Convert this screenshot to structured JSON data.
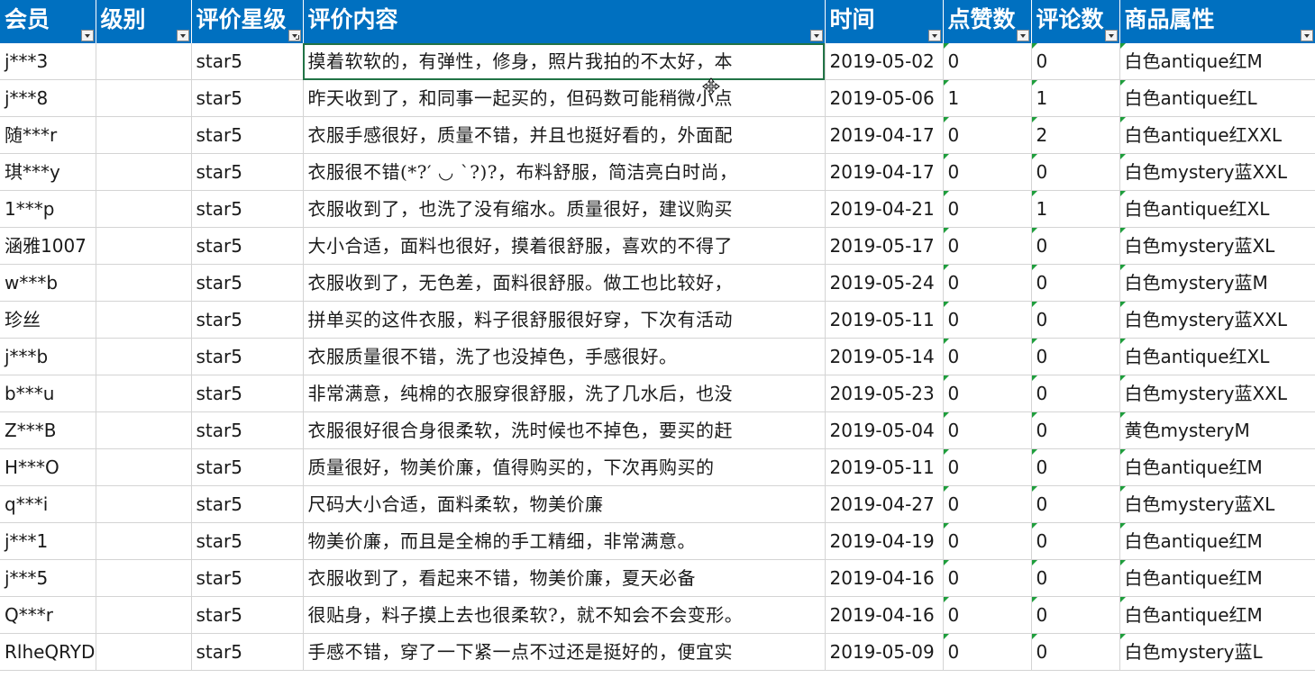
{
  "columns": [
    "会员",
    "级别",
    "评价星级",
    "评价内容",
    "时间",
    "点赞数",
    "评论数",
    "商品属性"
  ],
  "rows": [
    {
      "member": "j***3",
      "level": "",
      "stars": "star5",
      "content": "摸着软软的，有弹性，修身，照片我拍的不太好，本",
      "time": "2019-05-02",
      "likes": "0",
      "comments": "0",
      "attr": "白色antique红M"
    },
    {
      "member": "j***8",
      "level": "",
      "stars": "star5",
      "content": "昨天收到了，和同事一起买的，但码数可能稍微小点",
      "time": "2019-05-06",
      "likes": "1",
      "comments": "1",
      "attr": "白色antique红L"
    },
    {
      "member": "随***r",
      "level": "",
      "stars": "star5",
      "content": "衣服手感很好，质量不错，并且也挺好看的，外面配",
      "time": "2019-04-17",
      "likes": "0",
      "comments": "2",
      "attr": "白色antique红XXL"
    },
    {
      "member": "琪***y",
      "level": "",
      "stars": "star5",
      "content": "衣服很不错(*?′ ◡ `?)?，布料舒服，简洁亮白时尚，",
      "time": "2019-04-17",
      "likes": "0",
      "comments": "0",
      "attr": "白色mystery蓝XXL"
    },
    {
      "member": "1***p",
      "level": "",
      "stars": "star5",
      "content": "衣服收到了，也洗了没有缩水。质量很好，建议购买",
      "time": "2019-04-21",
      "likes": "0",
      "comments": "1",
      "attr": "白色antique红XL"
    },
    {
      "member": "涵雅1007",
      "level": "",
      "stars": "star5",
      "content": "大小合适，面料也很好，摸着很舒服，喜欢的不得了",
      "time": "2019-05-17",
      "likes": "0",
      "comments": "0",
      "attr": "白色mystery蓝XL"
    },
    {
      "member": "w***b",
      "level": "",
      "stars": "star5",
      "content": "衣服收到了，无色差，面料很舒服。做工也比较好，",
      "time": "2019-05-24",
      "likes": "0",
      "comments": "0",
      "attr": "白色mystery蓝M"
    },
    {
      "member": "珍丝",
      "level": "",
      "stars": "star5",
      "content": "拼单买的这件衣服，料子很舒服很好穿，下次有活动",
      "time": "2019-05-11",
      "likes": "0",
      "comments": "0",
      "attr": "白色mystery蓝XXL"
    },
    {
      "member": "j***b",
      "level": "",
      "stars": "star5",
      "content": "衣服质量很不错，洗了也没掉色，手感很好。",
      "time": "2019-05-14",
      "likes": "0",
      "comments": "0",
      "attr": "白色antique红XL"
    },
    {
      "member": "b***u",
      "level": "",
      "stars": "star5",
      "content": "非常满意，纯棉的衣服穿很舒服，洗了几水后，也没",
      "time": "2019-05-23",
      "likes": "0",
      "comments": "0",
      "attr": "白色mystery蓝XXL"
    },
    {
      "member": "Z***B",
      "level": "",
      "stars": "star5",
      "content": "衣服很好很合身很柔软，洗时候也不掉色，要买的赶",
      "time": "2019-05-04",
      "likes": "0",
      "comments": "0",
      "attr": "黄色mysteryM"
    },
    {
      "member": "H***O",
      "level": "",
      "stars": "star5",
      "content": "质量很好，物美价廉，值得购买的，下次再购买的",
      "time": "2019-05-11",
      "likes": "0",
      "comments": "0",
      "attr": "白色antique红M"
    },
    {
      "member": "q***i",
      "level": "",
      "stars": "star5",
      "content": "尺码大小合适，面料柔软，物美价廉",
      "time": "2019-04-27",
      "likes": "0",
      "comments": "0",
      "attr": "白色mystery蓝XL"
    },
    {
      "member": "j***1",
      "level": "",
      "stars": "star5",
      "content": "物美价廉，而且是全棉的手工精细，非常满意。",
      "time": "2019-04-19",
      "likes": "0",
      "comments": "0",
      "attr": "白色antique红M"
    },
    {
      "member": "j***5",
      "level": "",
      "stars": "star5",
      "content": "衣服收到了，看起来不错，物美价廉，夏天必备",
      "time": "2019-04-16",
      "likes": "0",
      "comments": "0",
      "attr": "白色antique红M"
    },
    {
      "member": "Q***r",
      "level": "",
      "stars": "star5",
      "content": "很贴身，料子摸上去也很柔软?，就不知会不会变形。",
      "time": "2019-04-16",
      "likes": "0",
      "comments": "0",
      "attr": "白色antique红M"
    },
    {
      "member": "RlheQRYD",
      "level": "",
      "stars": "star5",
      "content": "手感不错，穿了一下紧一点不过还是挺好的，便宜实",
      "time": "2019-05-09",
      "likes": "0",
      "comments": "0",
      "attr": "白色mystery蓝L"
    }
  ]
}
